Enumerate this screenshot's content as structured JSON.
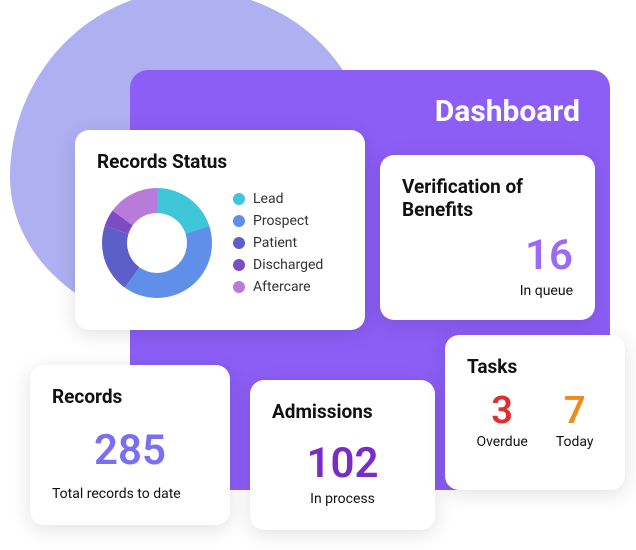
{
  "dashboard": {
    "title": "Dashboard"
  },
  "records_status": {
    "title": "Records Status",
    "legend": [
      {
        "label": "Lead",
        "color": "#3FC7D9"
      },
      {
        "label": "Prospect",
        "color": "#5F8FE8"
      },
      {
        "label": "Patient",
        "color": "#5B5FC7"
      },
      {
        "label": "Discharged",
        "color": "#7D4BC4"
      },
      {
        "label": "Aftercare",
        "color": "#B87BD9"
      }
    ]
  },
  "vob": {
    "title": "Verification of Benefits",
    "value": "16",
    "sub": "In queue"
  },
  "records": {
    "title": "Records",
    "value": "285",
    "sub": "Total records to date"
  },
  "admissions": {
    "title": "Admissions",
    "value": "102",
    "sub": "In process"
  },
  "tasks": {
    "title": "Tasks",
    "overdue_value": "3",
    "overdue_label": "Overdue",
    "today_value": "7",
    "today_label": "Today"
  },
  "chart_data": {
    "type": "pie",
    "title": "Records Status",
    "series": [
      {
        "name": "Lead",
        "value": 20,
        "color": "#3FC7D9"
      },
      {
        "name": "Prospect",
        "value": 40,
        "color": "#5F8FE8"
      },
      {
        "name": "Patient",
        "value": 20,
        "color": "#5B5FC7"
      },
      {
        "name": "Discharged",
        "value": 5,
        "color": "#7D4BC4"
      },
      {
        "name": "Aftercare",
        "value": 15,
        "color": "#B87BD9"
      }
    ]
  }
}
